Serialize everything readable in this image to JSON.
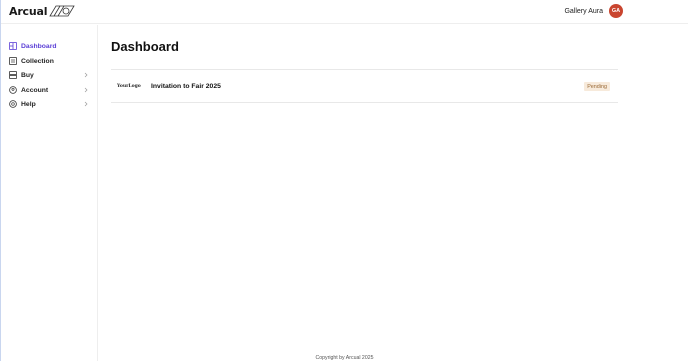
{
  "header": {
    "logo_text": "Arcual",
    "user_name": "Gallery Aura",
    "avatar_initials": "GA",
    "avatar_color": "#c9452f"
  },
  "sidebar": {
    "items": [
      {
        "label": "Dashboard",
        "icon": "dashboard-icon",
        "active": true,
        "has_chevron": false
      },
      {
        "label": "Collection",
        "icon": "collection-icon",
        "active": false,
        "has_chevron": false
      },
      {
        "label": "Buy",
        "icon": "buy-icon",
        "active": false,
        "has_chevron": true
      },
      {
        "label": "Account",
        "icon": "account-icon",
        "active": false,
        "has_chevron": true
      },
      {
        "label": "Help",
        "icon": "help-icon",
        "active": false,
        "has_chevron": true
      }
    ],
    "accent_color": "#5b3fd6"
  },
  "main": {
    "title": "Dashboard",
    "rows": [
      {
        "logo_text": "YourLogo",
        "title": "Invitation to Fair 2025",
        "status": "Pending",
        "status_bg": "#f7eadb",
        "status_color": "#9a6a37"
      }
    ]
  },
  "footer": {
    "text": "Copyright by Arcual 2025"
  }
}
